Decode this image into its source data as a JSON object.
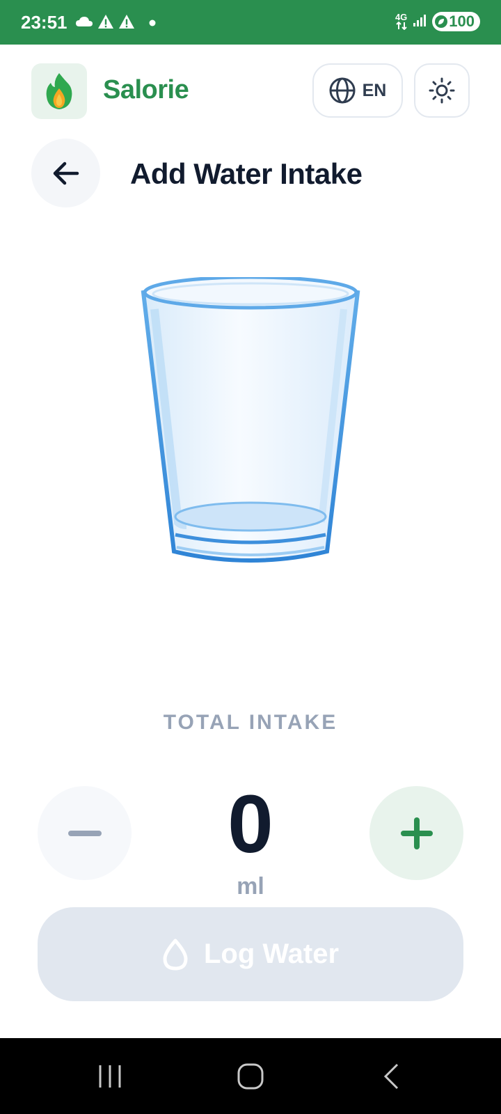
{
  "status_bar": {
    "time": "23:51",
    "network": "4G",
    "battery": "100",
    "icons": [
      "cloud-icon",
      "warning-icon",
      "warning-icon",
      "dot-icon",
      "signal-icon",
      "battery-saver-icon"
    ]
  },
  "header": {
    "app_name": "Salorie",
    "language": "EN",
    "icons": {
      "logo": "flame-drop-logo",
      "language": "globe-icon",
      "theme": "sun-icon"
    }
  },
  "page": {
    "title": "Add Water Intake",
    "back_icon": "arrow-left-icon"
  },
  "intake": {
    "label": "TOTAL INTAKE",
    "value": "0",
    "unit": "ml",
    "decrement_icon": "minus-icon",
    "increment_icon": "plus-icon"
  },
  "action": {
    "label": "Log Water",
    "icon": "water-drop-icon",
    "enabled": false
  },
  "nav_bar": {
    "icons": [
      "recents-icon",
      "home-icon",
      "back-icon"
    ]
  },
  "colors": {
    "brand": "#2a8f4f",
    "title_text": "#111b2e",
    "muted_text": "#97a3b6",
    "disabled_button": "#e1e7ef",
    "glass_blue": "#3d8fdc"
  }
}
